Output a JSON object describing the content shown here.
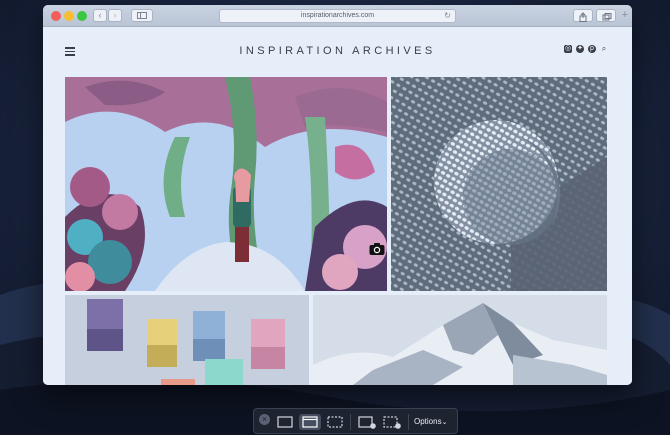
{
  "browser": {
    "url": "inspirationarchives.com",
    "back_glyph": "‹",
    "forward_glyph": "›",
    "reload_glyph": "↻",
    "new_tab_glyph": "+"
  },
  "site": {
    "title": "INSPIRATION ARCHIVES",
    "social_icons": [
      "instagram-icon",
      "twitter-icon",
      "pinterest-icon",
      "search-icon"
    ]
  },
  "gallery": {
    "tiles": [
      "forest-illustration",
      "halftone-sphere",
      "colored-cubes",
      "snowy-mountain"
    ]
  },
  "screenshot_toolbar": {
    "close_glyph": "×",
    "options_label": "Options",
    "options_chevron": "⌄"
  },
  "colors": {
    "page_bg": "#e6eef9",
    "text_dark": "#3a3f4a",
    "traffic_red": "#f25f58",
    "traffic_yellow": "#f9be2f",
    "traffic_green": "#3ac741"
  }
}
